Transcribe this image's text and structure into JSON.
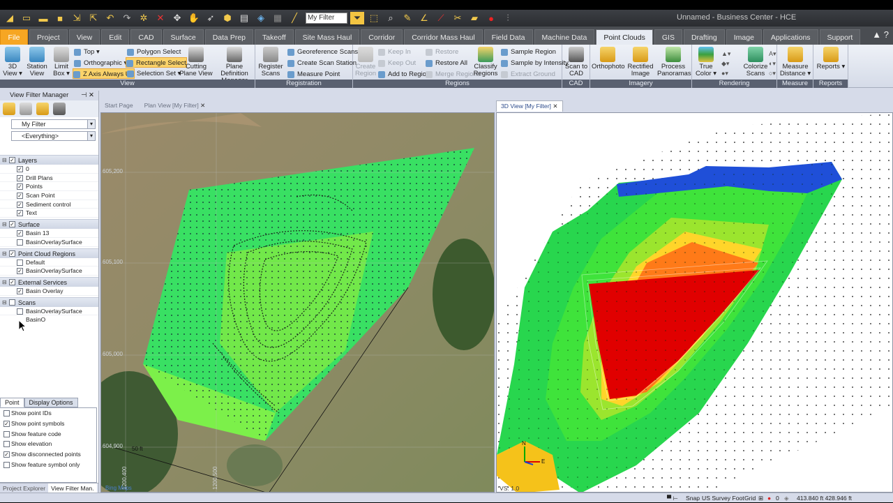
{
  "window": {
    "title": "Unnamed - Business Center - HCE"
  },
  "qat": {
    "filter_value": "My Filter"
  },
  "menu_tabs": [
    "File",
    "Project",
    "View",
    "Edit",
    "CAD",
    "Surface",
    "Data Prep",
    "Takeoff",
    "Site Mass Haul",
    "Corridor",
    "Corridor Mass Haul",
    "Field Data",
    "Machine Data",
    "Point Clouds",
    "GIS",
    "Drafting",
    "Image",
    "Applications",
    "Support"
  ],
  "active_tab": "Point Clouds",
  "ribbon": {
    "view": {
      "label": "View",
      "view3d": "3D View ▾",
      "station_view": "Station View",
      "limit_box": "Limit Box ▾",
      "top": "Top ▾",
      "orthographic": "Orthographic ▾",
      "z_axis_always_up": "Z Axis Always Up",
      "polygon_select": "Polygon Select",
      "rectangle_select": "Rectangle Select",
      "selection_set": "Selection Set ▾",
      "cutting_plane_view": "Cutting Plane View",
      "plane_definition_manager": "Plane Definition Manager"
    },
    "registration": {
      "label": "Registration",
      "register_scans": "Register Scans",
      "georeference_scans": "Georeference Scans",
      "create_scan_station": "Create Scan Station",
      "measure_point": "Measure Point"
    },
    "regions": {
      "label": "Regions",
      "create_region": "Create Region",
      "keep_in": "Keep In",
      "keep_out": "Keep Out",
      "add_to_region": "Add to Region",
      "restore": "Restore",
      "restore_all": "Restore All",
      "merge_regions": "Merge Regions",
      "classify_regions": "Classify Regions",
      "sample_region": "Sample Region",
      "sample_by_intensity": "Sample by Intensity",
      "extract_ground": "Extract Ground"
    },
    "cad": {
      "label": "CAD",
      "scan_to_cad": "Scan to CAD"
    },
    "imagery": {
      "label": "Imagery",
      "orthophoto": "Orthophoto",
      "rectified_image": "Rectified Image",
      "process_panoramas": "Process Panoramas"
    },
    "rendering": {
      "label": "Rendering",
      "true_color": "True Color ▾",
      "colorize_scans": "Colorize Scans"
    },
    "measure": {
      "label": "Measure",
      "measure_distance": "Measure Distance ▾"
    },
    "reports": {
      "label": "Reports",
      "reports": "Reports ▾"
    }
  },
  "left_panel": {
    "title": "View Filter Manager",
    "filter": "My Filter",
    "scope": "<Everything>",
    "categories": [
      {
        "name": "Layers",
        "checked": true,
        "items": [
          {
            "name": "0",
            "checked": true
          },
          {
            "name": "Drill Plans",
            "checked": true
          },
          {
            "name": "Points",
            "checked": true
          },
          {
            "name": "Scan Point",
            "checked": true
          },
          {
            "name": "Sediment control",
            "checked": true
          },
          {
            "name": "Text",
            "checked": true
          }
        ]
      },
      {
        "name": "Surface",
        "checked": true,
        "items": [
          {
            "name": "Basin 13",
            "checked": true
          },
          {
            "name": "BasinOverlaySurface",
            "checked": false
          }
        ]
      },
      {
        "name": "Point Cloud Regions",
        "checked": true,
        "items": [
          {
            "name": "Default",
            "checked": false
          },
          {
            "name": "BasinOverlaySurface",
            "checked": true
          }
        ]
      },
      {
        "name": "External Services",
        "checked": true,
        "items": [
          {
            "name": "Basin Overlay",
            "checked": true
          }
        ]
      },
      {
        "name": "Scans",
        "checked": false,
        "items": [
          {
            "name": "BasinOverlaySurface BasinO",
            "checked": false
          }
        ]
      }
    ],
    "option_tabs": [
      "Point",
      "Display Options"
    ],
    "options": [
      {
        "label": "Show point IDs",
        "checked": false
      },
      {
        "label": "Show point symbols",
        "checked": true
      },
      {
        "label": "Show feature code",
        "checked": false
      },
      {
        "label": "Show elevation",
        "checked": false
      },
      {
        "label": "Show disconnected points",
        "checked": true
      },
      {
        "label": "Show feature symbol only",
        "checked": false
      }
    ],
    "bottom_tabs": [
      "Project Explorer",
      "View Filter Man."
    ]
  },
  "doc_tabs_left": [
    "Start Page",
    "Plan View [My Filter]"
  ],
  "doc_tabs_right": [
    "3D View [My Filter]"
  ],
  "plan_view": {
    "grid_labels": [
      "605,200",
      "605,100",
      "605,000",
      "604,900",
      "50 ft",
      "1200,400",
      "1200,500"
    ],
    "source": "Bing Maps"
  },
  "view3d": {
    "scale_label": "VS: 1.0",
    "axis_x": "E",
    "axis_y": "N"
  },
  "status": {
    "snap": "Snap",
    "units": "US Survey Foot",
    "grid": "Grid",
    "count": "0",
    "coords": "413.840 ft 428.946 ft"
  },
  "colors": {
    "accent": "#f6a623",
    "ribbon_group": "#596070",
    "surface_green": "#2ee36c",
    "surface_red": "#e00000",
    "surface_blue": "#1f4fd8"
  }
}
